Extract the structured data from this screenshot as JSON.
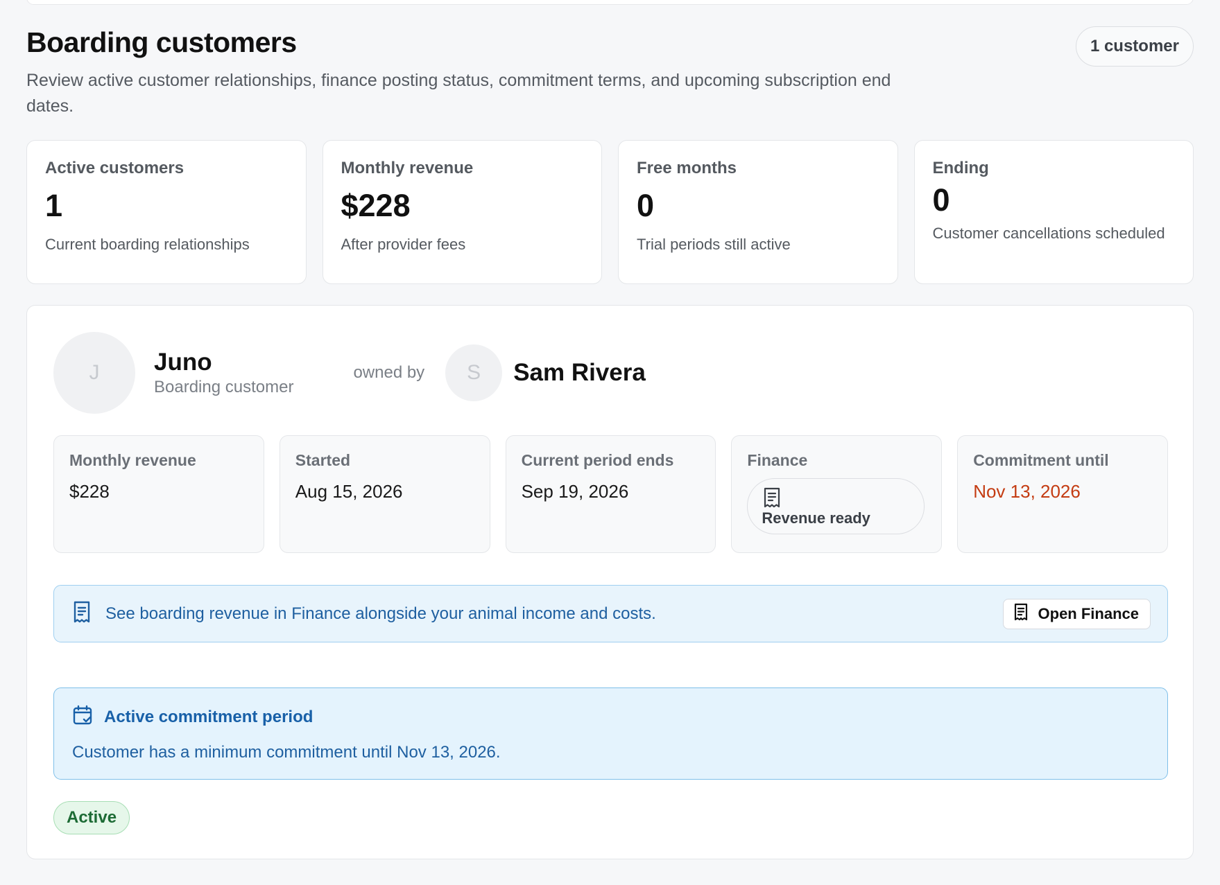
{
  "header": {
    "title": "Boarding customers",
    "subtitle": "Review active customer relationships, finance posting status, commitment terms, and upcoming subscription end dates.",
    "count_badge": "1 customer"
  },
  "stats": [
    {
      "label": "Active customers",
      "value": "1",
      "note": "Current boarding relationships"
    },
    {
      "label": "Monthly revenue",
      "value": "$228",
      "note": "After provider fees"
    },
    {
      "label": "Free months",
      "value": "0",
      "note": "Trial periods still active"
    },
    {
      "label": "Ending",
      "value": "0",
      "note": "Customer cancellations scheduled"
    }
  ],
  "customer": {
    "avatar_initial": "J",
    "name": "Juno",
    "role": "Boarding customer",
    "owned_by_label": "owned by",
    "owner_initial": "S",
    "owner_name": "Sam Rivera",
    "details": {
      "monthly_revenue_label": "Monthly revenue",
      "monthly_revenue_value": "$228",
      "started_label": "Started",
      "started_value": "Aug 15, 2026",
      "period_ends_label": "Current period ends",
      "period_ends_value": "Sep 19, 2026",
      "finance_label": "Finance",
      "finance_status": "Revenue ready",
      "commitment_label": "Commitment until",
      "commitment_value": "Nov 13, 2026"
    },
    "finance_banner": {
      "text": "See boarding revenue in Finance alongside your animal income and costs.",
      "button_label": "Open Finance",
      "icon": "receipt-icon"
    },
    "commitment": {
      "title": "Active commitment period",
      "body": "Customer has a minimum commitment until Nov 13, 2026.",
      "icon": "calendar-check-icon"
    },
    "status": "Active"
  },
  "colors": {
    "warning_date": "#c43c12",
    "info_text": "#1e5fa0",
    "info_bg": "#e4f3fd",
    "success_text": "#1d6b35",
    "success_bg": "#e6f7ea"
  }
}
